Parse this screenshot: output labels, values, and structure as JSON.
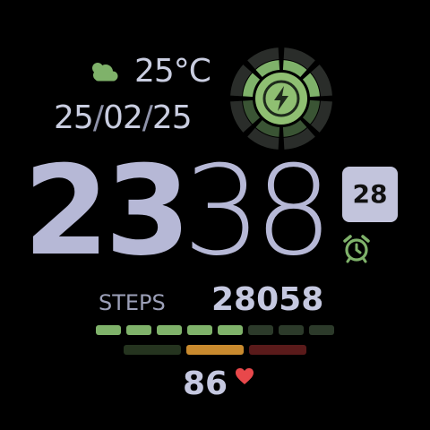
{
  "weather": {
    "icon": "cloud-sun-icon",
    "temperature": "25°C"
  },
  "date": {
    "day": "25",
    "separator": "/",
    "month": "02",
    "year": "25"
  },
  "battery": {
    "icon": "lightning-bolt-icon",
    "level": 0.5
  },
  "time": {
    "hours": "23",
    "minutes": "38",
    "seconds": "28"
  },
  "alarm": {
    "icon": "alarm-clock-icon"
  },
  "steps": {
    "label": "STEPS",
    "value": "28058",
    "goal_progress": 0.625
  },
  "heart_rate": {
    "value": "86",
    "icon": "heart-icon",
    "zone": 1
  },
  "colors": {
    "accent_green": "#7fb26a",
    "dim_green": "#2c3a2a",
    "time_color": "#b6b8d6",
    "zone_orange": "#c98a2e",
    "zone_red": "#5a1a1a",
    "heart_red": "#e8484b"
  }
}
